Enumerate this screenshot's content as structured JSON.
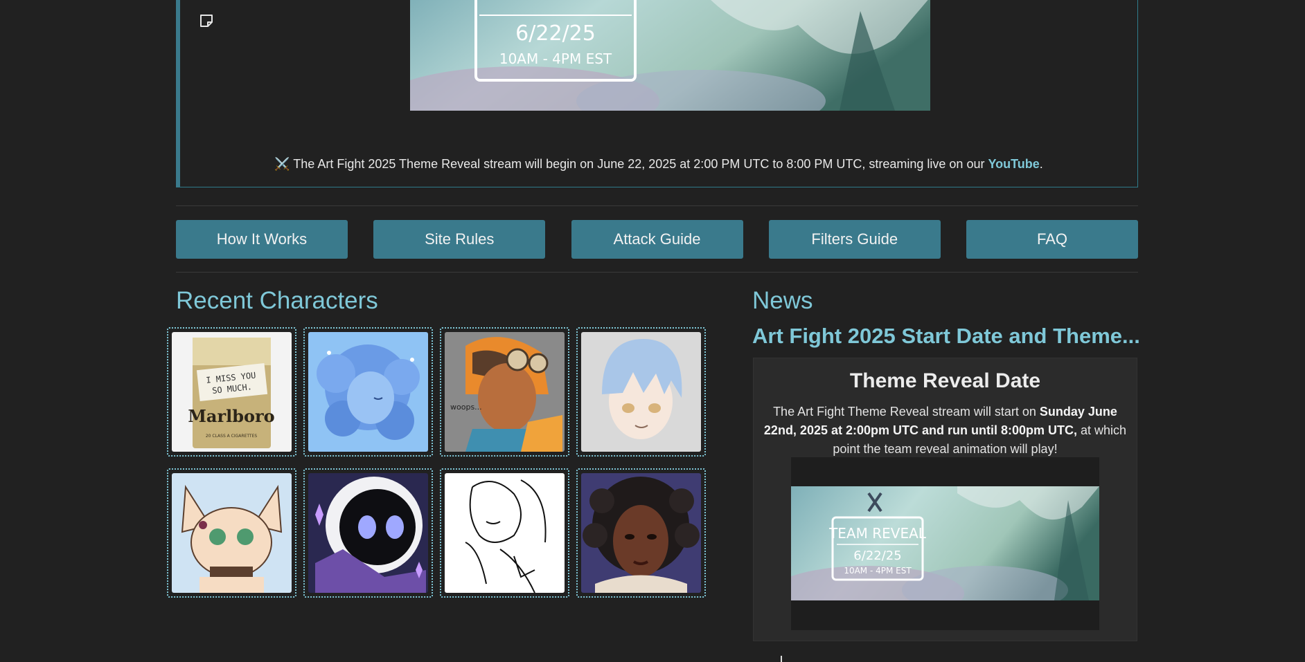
{
  "announcement": {
    "banner": {
      "date": "6/22/25",
      "time": "10AM - 4PM EST",
      "title": "TEAM REVEAL"
    },
    "emoji": "⚔️",
    "text": "The Art Fight 2025 Theme Reveal stream will begin on June 22, 2025 at 2:00 PM UTC to 8:00 PM UTC, streaming live on our",
    "link_label": "YouTube",
    "period": "."
  },
  "nav": {
    "items": [
      {
        "label": "How It Works"
      },
      {
        "label": "Site Rules"
      },
      {
        "label": "Attack Guide"
      },
      {
        "label": "Filters Guide"
      },
      {
        "label": "FAQ"
      }
    ]
  },
  "recent": {
    "title": "Recent Characters",
    "characters": [
      {
        "text_lines": [
          "I MISS YOU",
          "SO MUCH."
        ],
        "brand": "Marlboro",
        "sub": "20 CLASS A CIGARETTES"
      },
      {},
      {
        "text": "woops..."
      },
      {},
      {},
      {},
      {},
      {}
    ]
  },
  "news": {
    "title": "News",
    "post_title": "Art Fight 2025 Start Date and Theme...",
    "card_heading": "Theme Reveal Date",
    "body_before": "The Art Fight Theme Reveal stream will start on",
    "body_bold": "Sunday June 22nd, 2025 at 2:00pm UTC and run until 8:00pm UTC,",
    "body_after": "at which point the team reveal animation will play!",
    "video": {
      "title": "TEAM REVEAL",
      "date": "6/22/25",
      "time": "10AM - 4PM EST"
    }
  },
  "colors": {
    "accent": "#7fc8d8",
    "button": "#3a7a8c",
    "background": "#212121"
  }
}
